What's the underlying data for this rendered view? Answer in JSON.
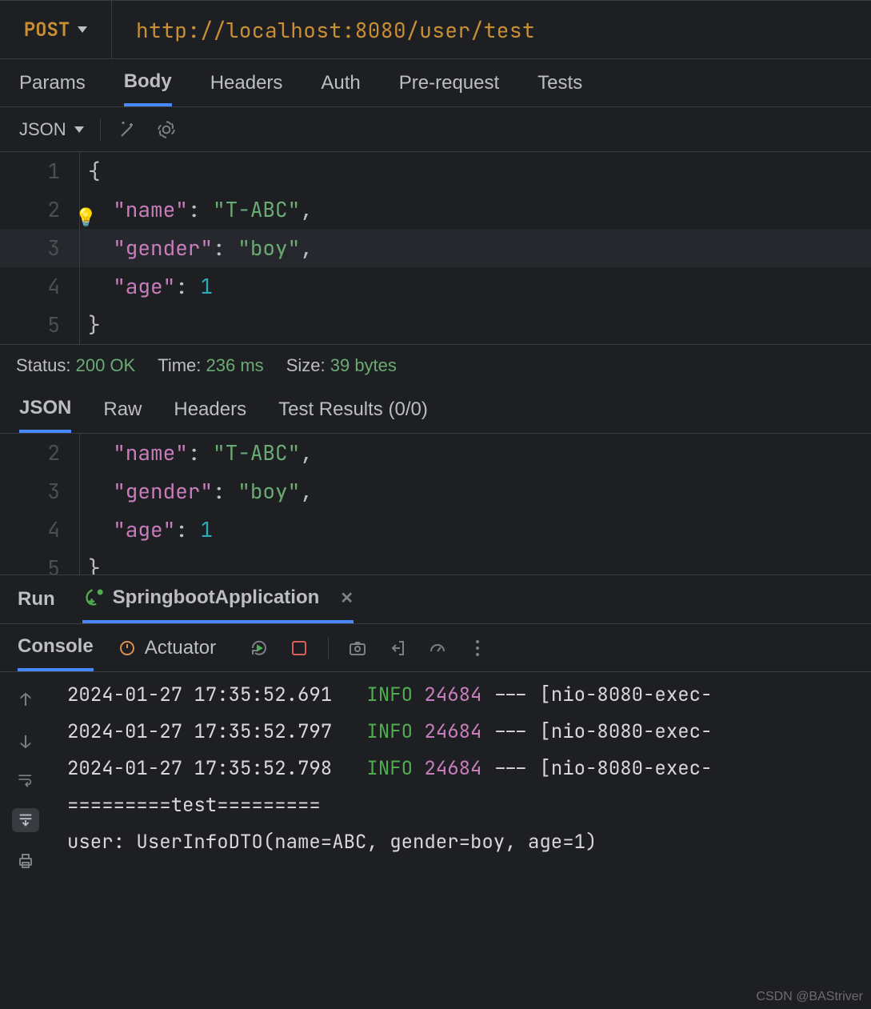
{
  "request": {
    "method": "POST",
    "url": "http://localhost:8080/user/test"
  },
  "reqTabs": [
    "Params",
    "Body",
    "Headers",
    "Auth",
    "Pre-request",
    "Tests"
  ],
  "reqTabActive": "Body",
  "bodyType": "JSON",
  "editor": {
    "lines": [
      {
        "n": "1",
        "raw": "{",
        "tokens": [
          {
            "t": "{",
            "c": "punc"
          }
        ]
      },
      {
        "n": "2",
        "raw": "  \"name\": \"T-ABC\",",
        "tokens": [
          {
            "t": "  ",
            "c": "punc"
          },
          {
            "t": "\"name\"",
            "c": "key"
          },
          {
            "t": ": ",
            "c": "punc"
          },
          {
            "t": "\"T-ABC\"",
            "c": "str"
          },
          {
            "t": ",",
            "c": "punc"
          }
        ],
        "bulb": true
      },
      {
        "n": "3",
        "raw": "  \"gender\": \"boy\",",
        "tokens": [
          {
            "t": "  ",
            "c": "punc"
          },
          {
            "t": "\"gender\"",
            "c": "key"
          },
          {
            "t": ": ",
            "c": "punc"
          },
          {
            "t": "\"boy\"",
            "c": "str"
          },
          {
            "t": ",",
            "c": "punc"
          }
        ],
        "hl": true
      },
      {
        "n": "4",
        "raw": "  \"age\": 1",
        "tokens": [
          {
            "t": "  ",
            "c": "punc"
          },
          {
            "t": "\"age\"",
            "c": "key"
          },
          {
            "t": ": ",
            "c": "punc"
          },
          {
            "t": "1",
            "c": "num"
          }
        ]
      },
      {
        "n": "5",
        "raw": "}",
        "tokens": [
          {
            "t": "}",
            "c": "punc"
          }
        ]
      }
    ]
  },
  "status": {
    "statusLabel": "Status:",
    "statusVal": "200 OK",
    "timeLabel": "Time:",
    "timeVal": "236 ms",
    "sizeLabel": "Size:",
    "sizeVal": "39 bytes"
  },
  "respTabs": [
    "JSON",
    "Raw",
    "Headers",
    "Test Results (0/0)"
  ],
  "respTabActive": "JSON",
  "respEditor": {
    "lines": [
      {
        "n": "2",
        "tokens": [
          {
            "t": "  ",
            "c": "punc"
          },
          {
            "t": "\"name\"",
            "c": "key"
          },
          {
            "t": ": ",
            "c": "punc"
          },
          {
            "t": "\"T-ABC\"",
            "c": "str"
          },
          {
            "t": ",",
            "c": "punc"
          }
        ]
      },
      {
        "n": "3",
        "tokens": [
          {
            "t": "  ",
            "c": "punc"
          },
          {
            "t": "\"gender\"",
            "c": "key"
          },
          {
            "t": ": ",
            "c": "punc"
          },
          {
            "t": "\"boy\"",
            "c": "str"
          },
          {
            "t": ",",
            "c": "punc"
          }
        ]
      },
      {
        "n": "4",
        "tokens": [
          {
            "t": "  ",
            "c": "punc"
          },
          {
            "t": "\"age\"",
            "c": "key"
          },
          {
            "t": ": ",
            "c": "punc"
          },
          {
            "t": "1",
            "c": "num"
          }
        ]
      },
      {
        "n": "5",
        "tokens": [
          {
            "t": "}",
            "c": "punc"
          }
        ]
      }
    ]
  },
  "runPanel": {
    "runLabel": "Run",
    "config": "SpringbootApplication"
  },
  "consoleTabs": {
    "console": "Console",
    "actuator": "Actuator"
  },
  "logLines": [
    {
      "ts": "2024-01-27 17:35:52.691",
      "lvl": "INFO",
      "pid": "24684",
      "sep": "---",
      "thr": "[nio-8080-exec-"
    },
    {
      "ts": "2024-01-27 17:35:52.797",
      "lvl": "INFO",
      "pid": "24684",
      "sep": "---",
      "thr": "[nio-8080-exec-"
    },
    {
      "ts": "2024-01-27 17:35:52.798",
      "lvl": "INFO",
      "pid": "24684",
      "sep": "---",
      "thr": "[nio-8080-exec-"
    }
  ],
  "logTail": [
    "=========test=========",
    "user: UserInfoDTO(name=ABC, gender=boy, age=1)"
  ],
  "watermark": "CSDN @BAStriver"
}
